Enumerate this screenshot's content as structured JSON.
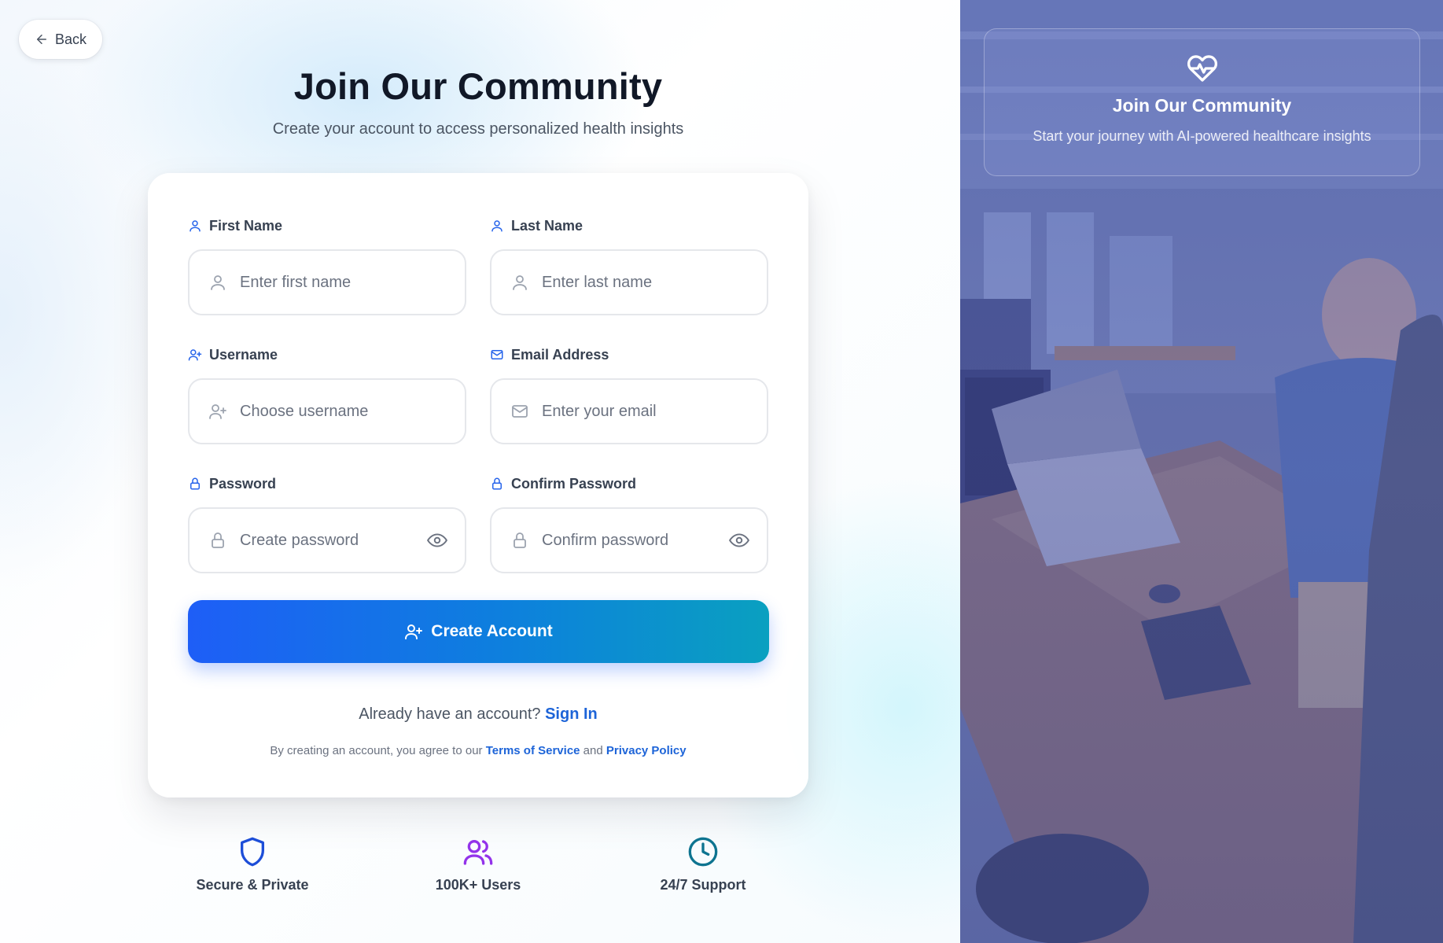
{
  "back": {
    "label": "Back"
  },
  "header": {
    "title": "Join Our Community",
    "subtitle": "Create your account to access personalized health insights"
  },
  "form": {
    "first_name": {
      "label": "First Name",
      "placeholder": "Enter first name",
      "value": ""
    },
    "last_name": {
      "label": "Last Name",
      "placeholder": "Enter last name",
      "value": ""
    },
    "username": {
      "label": "Username",
      "placeholder": "Choose username",
      "value": ""
    },
    "email": {
      "label": "Email Address",
      "placeholder": "Enter your email",
      "value": ""
    },
    "password": {
      "label": "Password",
      "placeholder": "Create password",
      "value": ""
    },
    "confirm_password": {
      "label": "Confirm Password",
      "placeholder": "Confirm password",
      "value": ""
    },
    "submit_label": "Create Account"
  },
  "signin": {
    "prompt": "Already have an account?",
    "link": "Sign In"
  },
  "terms": {
    "prefix": "By creating an account, you agree to our",
    "tos": "Terms of Service",
    "conj": "and",
    "privacy": "Privacy Policy"
  },
  "features": [
    {
      "label": "Secure & Private",
      "icon": "shield-icon",
      "color": "#1d4ed8"
    },
    {
      "label": "100K+ Users",
      "icon": "users-icon",
      "color": "#9333ea"
    },
    {
      "label": "24/7 Support",
      "icon": "clock-icon",
      "color": "#0e7490"
    }
  ],
  "promo": {
    "icon": "heart-pulse-icon",
    "title": "Join Our Community",
    "subtitle": "Start your journey with AI-powered healthcare insights"
  },
  "colors": {
    "accent": "#2563eb",
    "gradient_start": "#1e5ef7",
    "gradient_end": "#0aa0c0",
    "link": "#1d64d8"
  }
}
